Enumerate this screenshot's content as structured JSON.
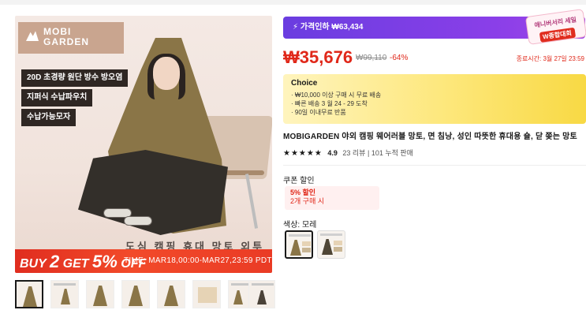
{
  "hero": {
    "brand_line1": "MOBI",
    "brand_line2": "GARDEN",
    "features": [
      "20D 초경량 원단 방수 방오염",
      "지퍼식 수납파우치",
      "수납가능모자"
    ],
    "slogan": "도심 캠핑 휴대 망토 외투",
    "promo_buy": "BUY",
    "promo_buy_num": "2",
    "promo_get": "GET",
    "promo_pct": "5%",
    "promo_off": "OFF",
    "promo_time": "TIME:  MAR18,00:00-MAR27,23:59 PDT"
  },
  "thumbnails": [
    {
      "name": "thumb-1",
      "style": "light",
      "selected": true
    },
    {
      "name": "thumb-2",
      "style": "chart"
    },
    {
      "name": "thumb-3",
      "style": "light"
    },
    {
      "name": "thumb-4",
      "style": "light"
    },
    {
      "name": "thumb-5",
      "style": "light"
    },
    {
      "name": "thumb-6",
      "style": "box"
    },
    {
      "name": "thumb-7",
      "style": "chart"
    },
    {
      "name": "thumb-8",
      "style": "chart"
    },
    {
      "name": "thumb-9",
      "style": "dark"
    }
  ],
  "price": {
    "banner_icon": "lightning-icon",
    "banner_text": "가격인하 ₩63,434",
    "tag_line1": "애니버서리 세일",
    "tag_line2": "W종합대회",
    "current": "₩35,676",
    "original": "₩99,110",
    "discount": "-64%",
    "sale_end": "종료시간: 3월 27일 23:59",
    "accent": "#e0281a",
    "banner_color": "#7a3ee6"
  },
  "choice": {
    "title": "Choice",
    "lines": [
      "· ₩10,000 이상 구매 시 무료 배송",
      "· 빠른 배송 3 월 24 - 29 도착",
      "· 90일 이내무료 반품"
    ]
  },
  "product": {
    "title": "MOBIGARDEN 야외 캠핑 웨어러블 망토, 면 침낭, 성인 따뜻한 휴대용 숄, 닫 쫒는 망토",
    "stars": "★★★★★",
    "rating": "4.9",
    "reviews": "23 리뷰",
    "sold": "101 누적 판매"
  },
  "coupon": {
    "label": "쿠폰 할인",
    "pct": "5% 할인",
    "cond": "2개 구매 시"
  },
  "color": {
    "label": "색상: 모레",
    "options": [
      "모레",
      "다크"
    ]
  }
}
